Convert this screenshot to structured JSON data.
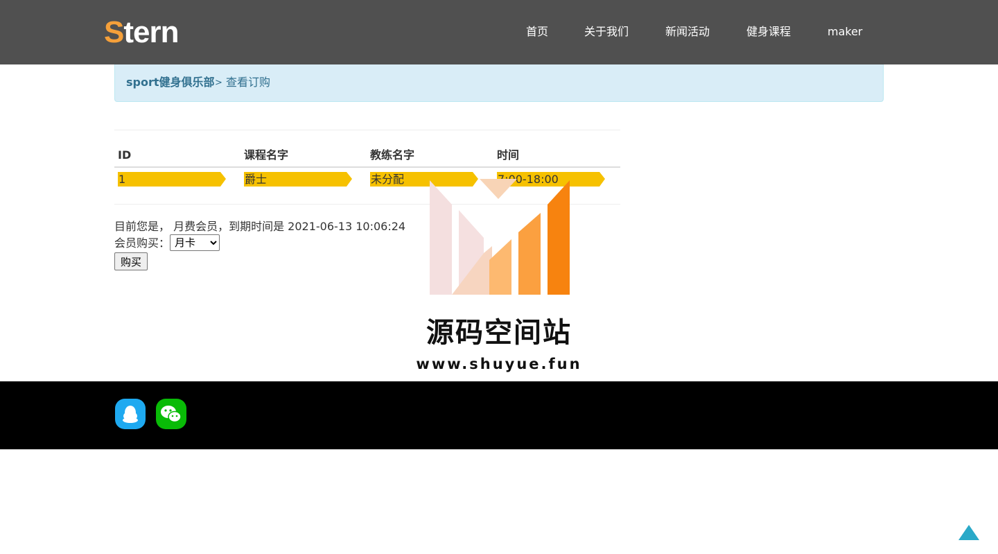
{
  "header": {
    "logo_first": "S",
    "logo_rest": "tern",
    "nav": [
      {
        "label": "首页"
      },
      {
        "label": "关于我们"
      },
      {
        "label": "新闻活动"
      },
      {
        "label": "健身课程"
      },
      {
        "label": "maker"
      }
    ]
  },
  "breadcrumb": {
    "home": "sport健身俱乐部",
    "separator": ">",
    "current": "查看订购"
  },
  "table": {
    "headers": [
      "ID",
      "课程名字",
      "教练名字",
      "时间"
    ],
    "rows": [
      [
        "1",
        "爵士",
        "未分配",
        "7:00-18:00"
      ]
    ]
  },
  "membership": {
    "status_text": "目前您是， 月费会员，到期时间是 2021-06-13 10:06:24",
    "buy_label": "会员购买：",
    "selected_option": "月卡",
    "buy_button": "购买"
  },
  "watermark": {
    "title": "源码空间站",
    "url": "www.shuyue.fun"
  },
  "footer": {
    "icons": [
      "qq-icon",
      "wechat-icon"
    ]
  },
  "colors": {
    "header_bg": "#505050",
    "logo_accent": "#f5a03a",
    "breadcrumb_bg": "#d9edf7",
    "row_highlight": "#f6c100",
    "footer_bg": "#000000",
    "qq_blue": "#1ea9f0",
    "wechat_green": "#09bb07",
    "back_to_top": "#2aa9c8"
  }
}
